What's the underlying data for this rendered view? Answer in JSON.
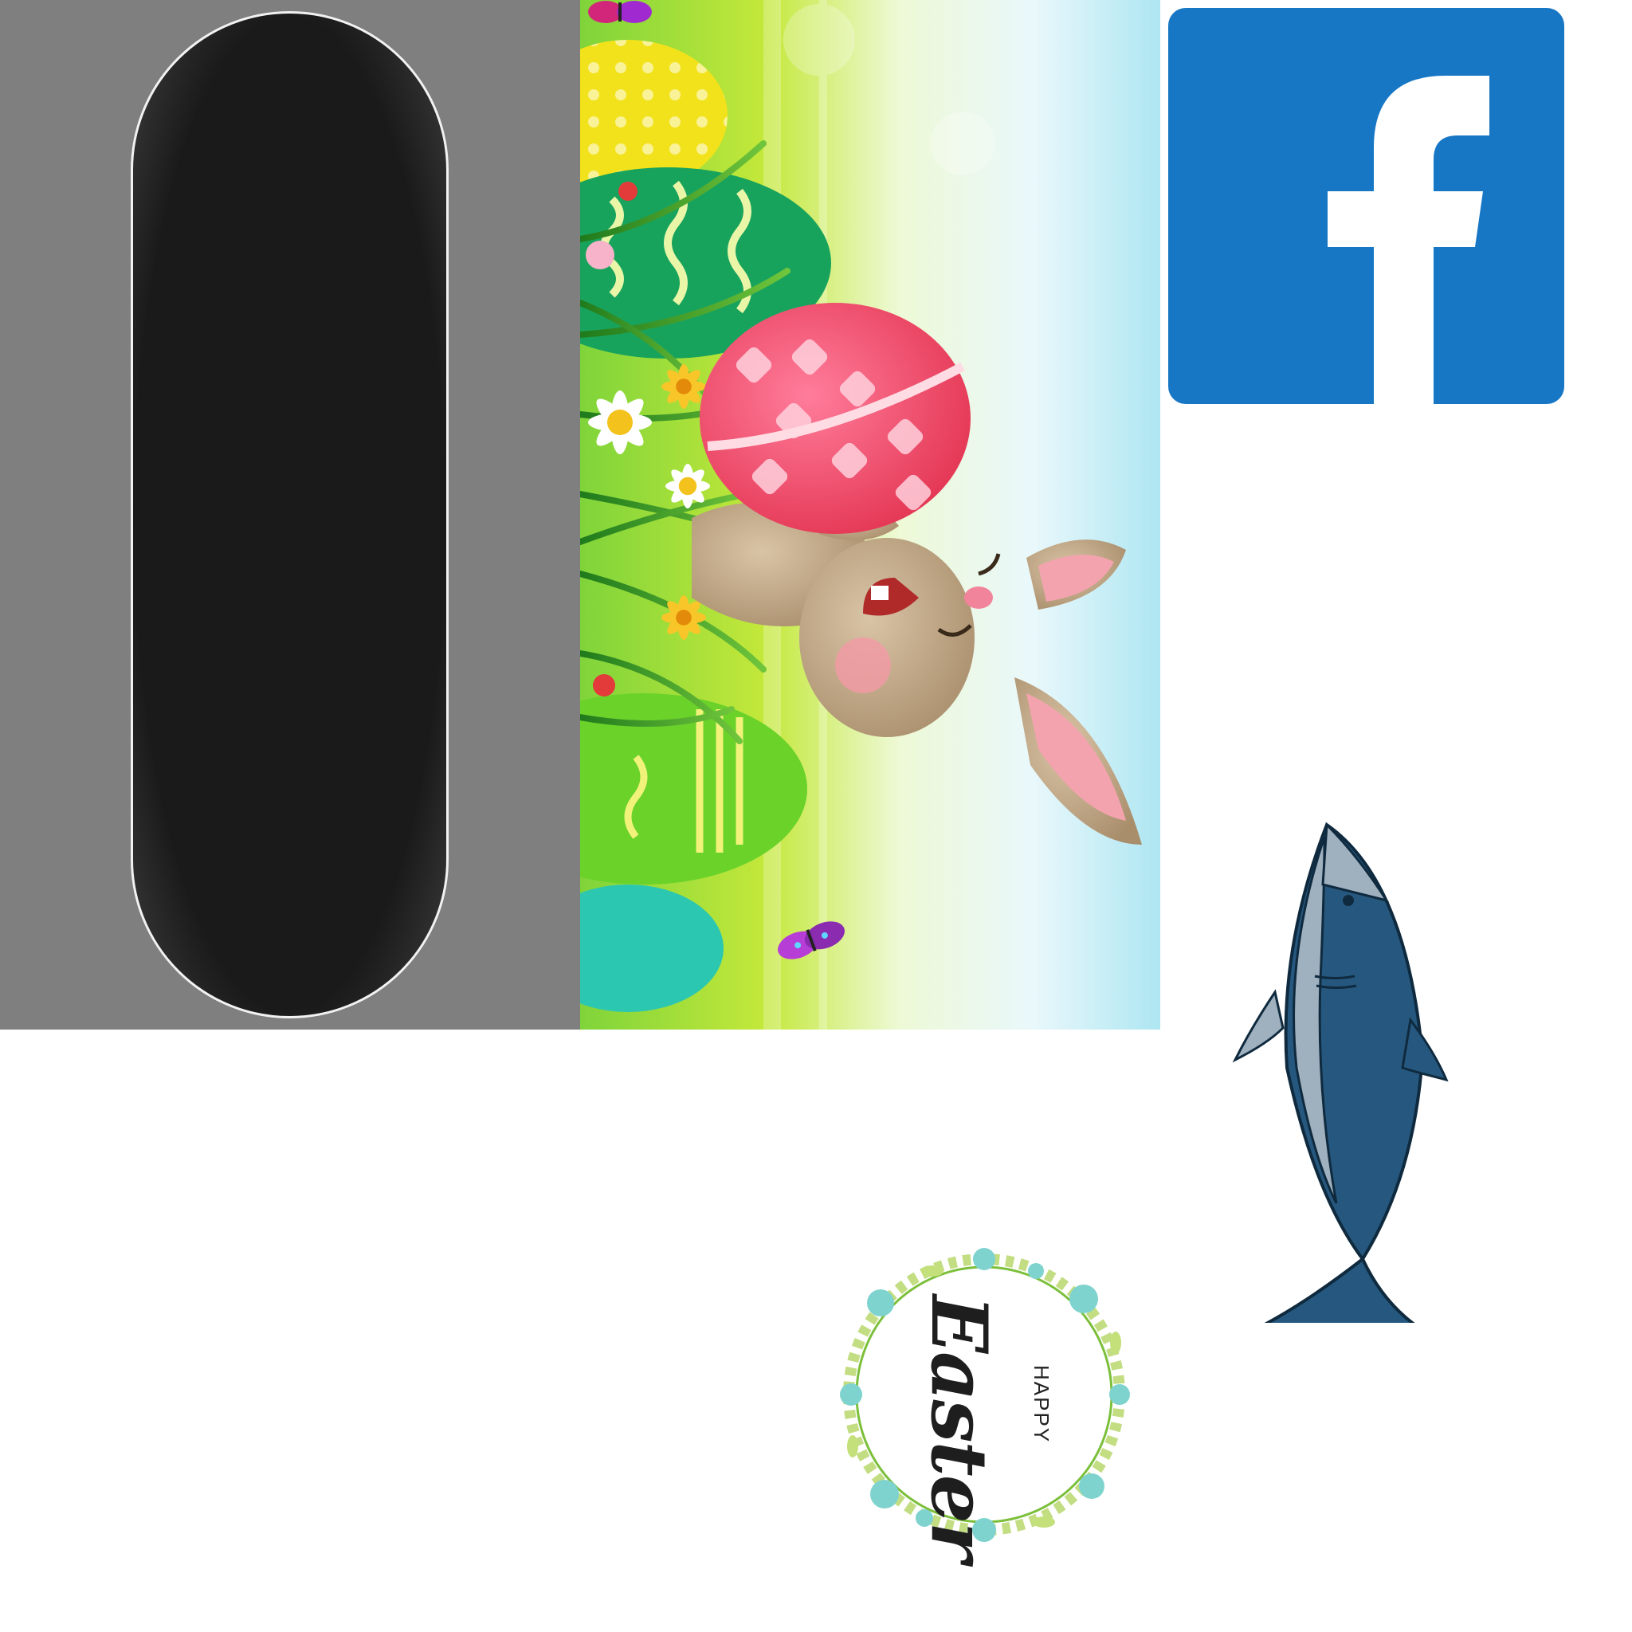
{
  "colors": {
    "panel_gray": "#7f7f7f",
    "facebook_blue": "#1877c5",
    "shark_blue": "#26587f"
  },
  "icons": {
    "facebook": "facebook-logo-icon",
    "shark": "shark-icon",
    "butterfly": "butterfly-icon"
  },
  "easter_wreath": {
    "main_word": "Easter",
    "small_word": "HAPPY"
  }
}
